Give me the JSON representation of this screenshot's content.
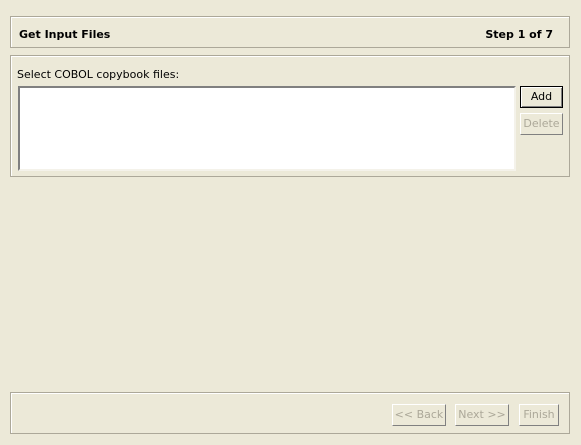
{
  "header": {
    "title": "Get Input Files",
    "step": "Step 1 of 7"
  },
  "files": {
    "label": "Select COBOL copybook files:",
    "items": [],
    "add_label": "Add",
    "delete_label": "Delete"
  },
  "footer": {
    "back_label": "<< Back",
    "next_label": "Next >>",
    "finish_label": "Finish"
  }
}
